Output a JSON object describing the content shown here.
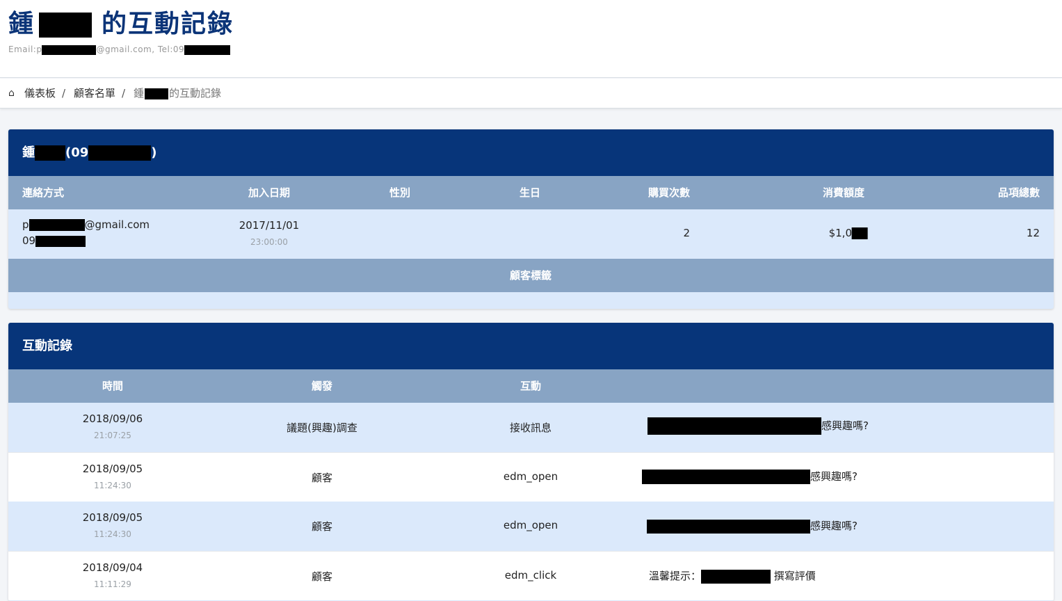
{
  "header": {
    "title_prefix": "鍾",
    "title_suffix": "的互動記錄",
    "sub_email_prefix": "Email:p",
    "sub_email_suffix": "@gmail.com, Tel:09"
  },
  "breadcrumb": {
    "home_icon": "home-icon",
    "items": [
      "儀表板",
      "顧客名單"
    ],
    "separator": "/",
    "current_prefix": "鍾",
    "current_suffix": "的互動記錄"
  },
  "customer_card": {
    "title_prefix": "鍾",
    "title_mid": "(09",
    "title_suffix": ")",
    "columns": [
      "連絡方式",
      "加入日期",
      "性別",
      "生日",
      "購買次數",
      "消費額度",
      "品項總數"
    ],
    "row": {
      "email_prefix": "p",
      "email_suffix": "@gmail.com",
      "phone_prefix": "09",
      "join_date": "2017/11/01",
      "join_time": "23:00:00",
      "gender": "",
      "birthday": "",
      "purchase_count": "2",
      "spend_prefix": "$1,0",
      "item_total": "12"
    },
    "tags_label": "顧客標籤"
  },
  "interaction_card": {
    "title": "互動記錄",
    "columns": [
      "時間",
      "觸發",
      "互動"
    ],
    "rows": [
      {
        "date": "2018/09/06",
        "time": "21:07:25",
        "trigger": "議題(興趣)調查",
        "action": "接收訊息",
        "content_suffix": "感興趣嗎?"
      },
      {
        "date": "2018/09/05",
        "time": "11:24:30",
        "trigger": "顧客",
        "action": "edm_open",
        "content_suffix": "感興趣嗎?"
      },
      {
        "date": "2018/09/05",
        "time": "11:24:30",
        "trigger": "顧客",
        "action": "edm_open",
        "content_suffix": "感興趣嗎?"
      },
      {
        "date": "2018/09/04",
        "time": "11:11:29",
        "trigger": "顧客",
        "action": "edm_click",
        "content_prefix": "溫馨提示：",
        "content_suffix": "撰寫評價"
      }
    ]
  },
  "colors": {
    "title_blue": "#0b3478",
    "card_header": "#07357a",
    "table_header": "#88a4c4",
    "row_alt": "#dbe9fb"
  }
}
